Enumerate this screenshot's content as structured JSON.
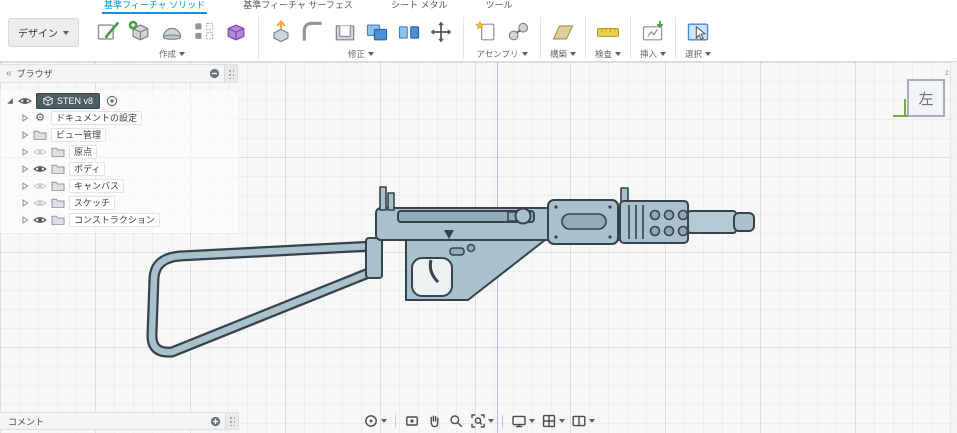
{
  "tabs": [
    {
      "label": "基準フィーチャ ソリッド"
    },
    {
      "label": "基準フィーチャ サーフェス"
    },
    {
      "label": "シート メタル"
    },
    {
      "label": "ツール"
    }
  ],
  "design_menu": {
    "label": "デザイン"
  },
  "toolbar": {
    "create": {
      "label": "作成"
    },
    "modify": {
      "label": "修正"
    },
    "assemble": {
      "label": "アセンブリ"
    },
    "construct": {
      "label": "構築"
    },
    "inspect": {
      "label": "検査"
    },
    "insert": {
      "label": "挿入"
    },
    "select": {
      "label": "選択"
    }
  },
  "browser": {
    "title": "ブラウザ",
    "collapse_glyph": "«",
    "root": {
      "label": "STEN v8",
      "visible": true
    },
    "items": [
      {
        "label": "ドキュメントの設定",
        "icon": "gear"
      },
      {
        "label": "ビュー管理",
        "icon": "folder"
      },
      {
        "label": "原点",
        "icon": "folder",
        "visible": false
      },
      {
        "label": "ボディ",
        "icon": "folder",
        "visible": true
      },
      {
        "label": "キャンバス",
        "icon": "folder",
        "visible": false
      },
      {
        "label": "スケッチ",
        "icon": "folder",
        "visible": false
      },
      {
        "label": "コンストラクション",
        "icon": "folder",
        "visible": true
      }
    ]
  },
  "glyphs": {
    "gear": "⚙"
  },
  "viewcube": {
    "face": "左",
    "axis_z": "z"
  },
  "comments": {
    "title": "コメント"
  },
  "colors": {
    "accent": "#0696d7",
    "model_steel": "#a9c0cd",
    "model_outline": "#37424a"
  }
}
